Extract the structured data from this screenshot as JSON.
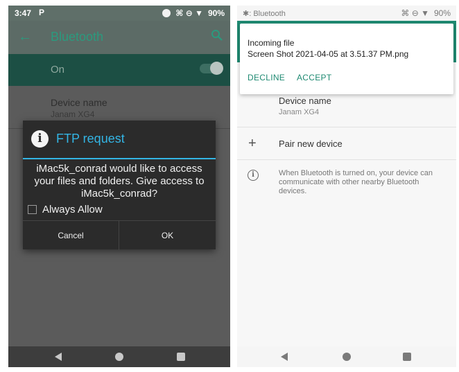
{
  "left": {
    "status": {
      "time": "3:47",
      "app_badge": "P",
      "icons_text": "⌘ ⊖ ▼",
      "battery": "90%"
    },
    "appbar": {
      "title": "Bluetooth"
    },
    "toggle_row": {
      "label": "On",
      "state": "on"
    },
    "device": {
      "label": "Device name",
      "value": "Janam XG4"
    },
    "dialog": {
      "title": "FTP request",
      "message": "iMac5k_conrad would like to access your files and folders. Give access to iMac5k_conrad?",
      "checkbox_label": "Always Allow",
      "checkbox_checked": false,
      "cancel_label": "Cancel",
      "ok_label": "OK"
    }
  },
  "right": {
    "status": {
      "app": "Bluetooth",
      "battery": "90%"
    },
    "notification": {
      "title": "Incoming file",
      "filename": "Screen Shot 2021-04-05 at 3.51.37 PM.png",
      "decline_label": "DECLINE",
      "accept_label": "ACCEPT"
    },
    "device": {
      "label": "Device name",
      "value": "Janam XG4"
    },
    "pair_label": "Pair new device",
    "info_text": "When Bluetooth is turned on, your device can communicate with other nearby Bluetooth devices."
  },
  "colors": {
    "accent_teal": "#1f8a72",
    "dialog_blue": "#33b5e5"
  }
}
